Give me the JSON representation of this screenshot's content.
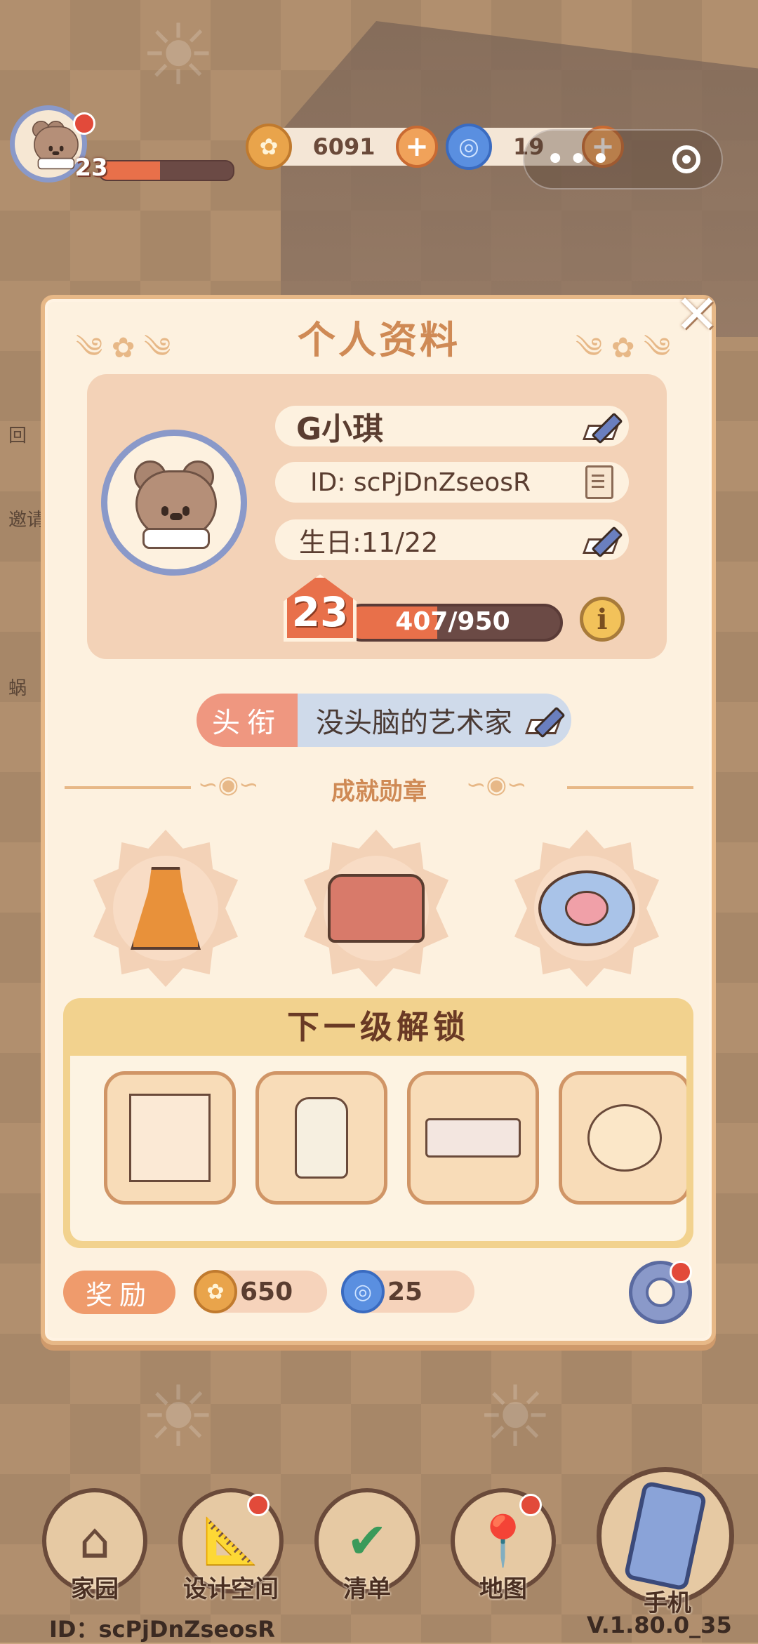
{
  "hud": {
    "player_level": "23",
    "level_progress": 0.45,
    "coins": "6091",
    "gems": "19",
    "menu_dots": "•••"
  },
  "side_labels": [
    "回",
    "邀请",
    "蜗"
  ],
  "modal": {
    "title": "个人资料",
    "close_glyph": "✕",
    "name": "G小琪",
    "id_text": "ID: scPjDnZseosR",
    "birthday": "生日:11/22",
    "level": "23",
    "xp_text": "407/950",
    "xp_current": 407,
    "xp_max": 950,
    "info_glyph": "i",
    "title_tag": "头衔",
    "title_value": "没头脑的艺术家",
    "achievements_title": "成就勋章",
    "achievements": [
      {
        "name": "dress-badge"
      },
      {
        "name": "armchair-badge"
      },
      {
        "name": "paw-badge"
      }
    ],
    "unlock_title": "下一级解锁",
    "unlock_items": [
      "cabinet",
      "detergent-bottle",
      "wall-shelf",
      "kettle"
    ],
    "reward_label": "奖励",
    "reward_coins": "650",
    "reward_gems": "25"
  },
  "nav": [
    {
      "label": "家园"
    },
    {
      "label": "设计空间"
    },
    {
      "label": "清单"
    },
    {
      "label": "地图"
    },
    {
      "label": "手机"
    }
  ],
  "footer": {
    "id_text": "ID：scPjDnZseosR",
    "version": "V.1.80.0_35"
  },
  "colors": {
    "accent_orange": "#e8704a",
    "panel_bg": "#fdf1df",
    "title_color": "#cf8a55",
    "avatar_ring": "#8a99c9"
  }
}
